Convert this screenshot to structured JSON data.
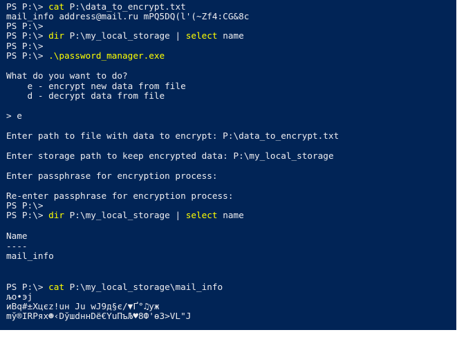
{
  "lines": [
    {
      "prompt": "PS P:\\> ",
      "cmd": "cat",
      "rest": " P:\\data_to_encrypt.txt"
    },
    {
      "text": "mail_info address@mail.ru mPQ5DQ(l'(~Zf4:CG&8c"
    },
    {
      "prompt": "PS P:\\>"
    },
    {
      "prompt": "PS P:\\> ",
      "cmd": "dir",
      "rest": " P:\\my_local_storage | ",
      "cmd2": "select",
      "rest2": " name"
    },
    {
      "prompt": "PS P:\\>"
    },
    {
      "prompt": "PS P:\\> ",
      "cmd": ".\\password_manager.exe"
    },
    {
      "text": "What do you want to do?"
    },
    {
      "text": "    e - encrypt new data from file"
    },
    {
      "text": "    d - decrypt data from file"
    },
    {
      "text": "> e"
    },
    {
      "text": "Enter path to file with data to encrypt: P:\\data_to_encrypt.txt"
    },
    {
      "text": "Enter storage path to keep encrypted data: P:\\my_local_storage"
    },
    {
      "text": "Enter passphrase for encryption process:"
    },
    {
      "text": "Re-enter passphrase for encryption process:"
    },
    {
      "prompt": "PS P:\\>"
    },
    {
      "prompt": "PS P:\\> ",
      "cmd": "dir",
      "rest": " P:\\my_local_storage | ",
      "cmd2": "select",
      "rest2": " name"
    },
    {
      "text": "Name"
    },
    {
      "text": "----"
    },
    {
      "text": "mail_info"
    },
    {
      "prompt": "PS P:\\> ",
      "cmd": "cat",
      "rest": " P:\\my_local_storage\\mail_info"
    },
    {
      "text": "љo•эj"
    },
    {
      "text": "иBq#±Xцєz!uн Ju wJ9д§є/▼Ґ°♫уж"
    },
    {
      "text": "mў®IRPяx☻‹DўшdннDё€YuПъЉ♥8Ф'ѳ3>VL\"J"
    }
  ]
}
